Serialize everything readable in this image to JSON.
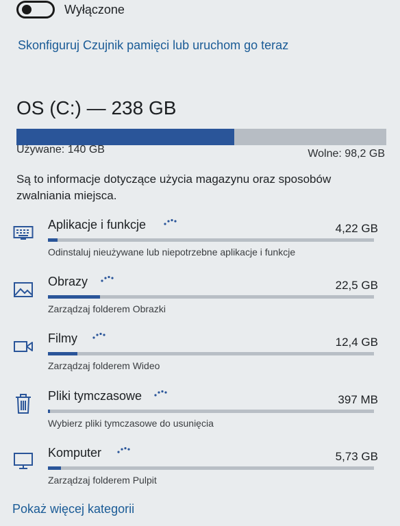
{
  "storage_sense": {
    "toggle_state": "off",
    "toggle_label": "Wyłączone",
    "config_link": "Skonfiguruj Czujnik pamięci lub uruchom go teraz"
  },
  "drive": {
    "title": "OS (C:) — 238 GB",
    "used_label": "Używane: 140 GB",
    "free_label": "Wolne: 98,2 GB",
    "used_fraction": 0.588
  },
  "description": "Są to informacje dotyczące użycia magazynu oraz sposobów zwalniania miejsca.",
  "categories": [
    {
      "name": "Aplikacje i funkcje",
      "size": "4,22 GB",
      "description": "Odinstaluj nieużywane lub niepotrzebne aplikacje i funkcje",
      "icon": "keyboard-icon",
      "fraction": 0.03
    },
    {
      "name": "Obrazy",
      "size": "22,5 GB",
      "description": "Zarządzaj folderem Obrazki",
      "icon": "image-icon",
      "fraction": 0.16
    },
    {
      "name": "Filmy",
      "size": "12,4 GB",
      "description": "Zarządzaj folderem Wideo",
      "icon": "video-icon",
      "fraction": 0.09
    },
    {
      "name": "Pliki tymczasowe",
      "size": "397 MB",
      "description": "Wybierz pliki tymczasowe do usunięcia",
      "icon": "trash-icon",
      "fraction": 0.005
    },
    {
      "name": "Komputer",
      "size": "5,73 GB",
      "description": "Zarządzaj folderem Pulpit",
      "icon": "monitor-icon",
      "fraction": 0.04
    }
  ],
  "more_link": "Pokaż więcej kategorii",
  "colors": {
    "accent": "#2a5599",
    "link": "#1a5b96",
    "bar_bg": "#b8bec5"
  }
}
